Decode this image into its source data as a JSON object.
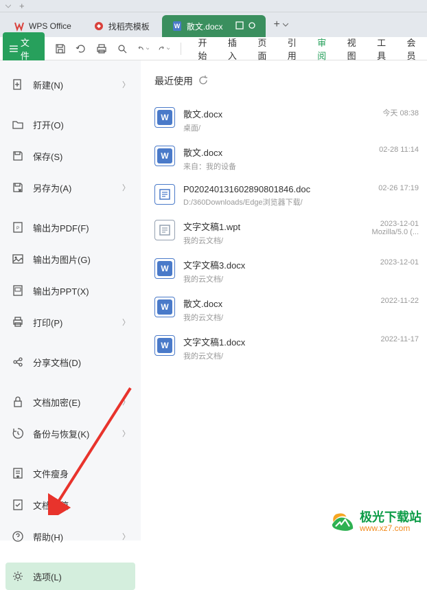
{
  "window": {
    "title_tab": "+"
  },
  "tabs": {
    "items": [
      {
        "label": "WPS Office",
        "icon_color": "#d9413c"
      },
      {
        "label": "找稻壳模板",
        "icon_color": "#d9413c"
      },
      {
        "label": "散文.docx",
        "icon_color": "#4a7ac9"
      }
    ],
    "add": "+"
  },
  "toolbar": {
    "file": "文件",
    "menu": [
      "开始",
      "插入",
      "页面",
      "引用",
      "审阅",
      "视图",
      "工具",
      "会员"
    ],
    "active_menu_index": 4
  },
  "sidemenu": {
    "items": [
      {
        "label": "新建(N)",
        "arrow": true,
        "icon": "plus-doc"
      },
      {
        "label": "打开(O)",
        "arrow": false,
        "icon": "folder"
      },
      {
        "label": "保存(S)",
        "arrow": false,
        "icon": "save"
      },
      {
        "label": "另存为(A)",
        "arrow": true,
        "icon": "save-as"
      },
      {
        "label": "输出为PDF(F)",
        "arrow": false,
        "icon": "pdf"
      },
      {
        "label": "输出为图片(G)",
        "arrow": false,
        "icon": "image"
      },
      {
        "label": "输出为PPT(X)",
        "arrow": false,
        "icon": "ppt"
      },
      {
        "label": "打印(P)",
        "arrow": true,
        "icon": "print"
      },
      {
        "label": "分享文档(D)",
        "arrow": false,
        "icon": "share"
      },
      {
        "label": "文档加密(E)",
        "arrow": true,
        "icon": "lock"
      },
      {
        "label": "备份与恢复(K)",
        "arrow": true,
        "icon": "backup"
      },
      {
        "label": "文件瘦身",
        "arrow": false,
        "icon": "compress"
      },
      {
        "label": "文档定稿",
        "arrow": false,
        "icon": "final"
      },
      {
        "label": "帮助(H)",
        "arrow": true,
        "icon": "help"
      },
      {
        "label": "选项(L)",
        "arrow": false,
        "icon": "options",
        "selected": true
      }
    ]
  },
  "recent": {
    "title": "最近使用",
    "files": [
      {
        "name": "散文.docx",
        "path": "桌面/",
        "date": "今天 08:38",
        "type": "word"
      },
      {
        "name": "散文.docx",
        "path": "来自：我的设备",
        "date": "02-28 11:14",
        "type": "word"
      },
      {
        "name": "P020240131602890801846.doc",
        "path": "D:/360Downloads/Edge浏览器下载/",
        "date": "02-26 17:19",
        "type": "writer"
      },
      {
        "name": "文字文稿1.wpt",
        "path": "我的云文档/",
        "date": "2023-12-01\nMozilla/5.0 (...",
        "type": "wpt"
      },
      {
        "name": "文字文稿3.docx",
        "path": "我的云文档/",
        "date": "2023-12-01",
        "type": "word"
      },
      {
        "name": "散文.docx",
        "path": "我的云文档/",
        "date": "2022-11-22",
        "type": "word"
      },
      {
        "name": "文字文稿1.docx",
        "path": "我的云文档/",
        "date": "2022-11-17",
        "type": "word"
      }
    ]
  },
  "watermark": {
    "title": "极光下载站",
    "url": "www.xz7.com"
  }
}
